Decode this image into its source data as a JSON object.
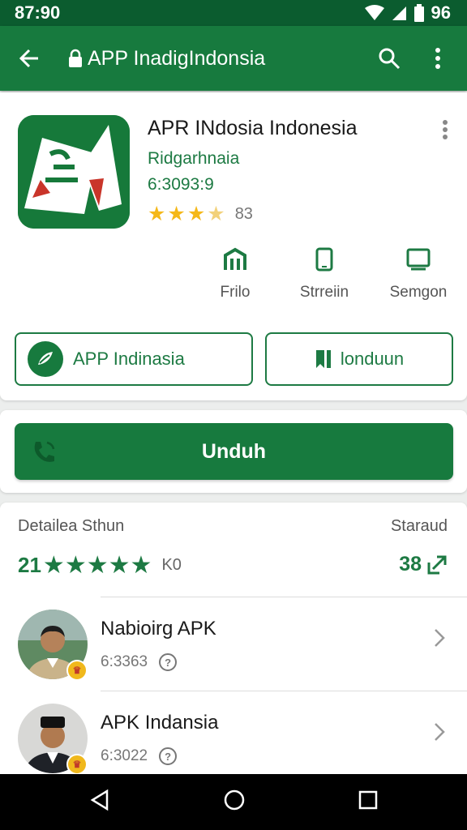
{
  "status_bar": {
    "time": "87:90",
    "battery": "96"
  },
  "app_bar": {
    "title": "APP InadigIndonsia"
  },
  "app": {
    "name": "APR INdosia Indonesia",
    "developer": "Ridgarhnaia",
    "version": "6:3093:9",
    "rating_count": "83",
    "stars": {
      "filled": 3,
      "half": 1,
      "total": 4
    }
  },
  "features": [
    {
      "icon": "building-icon",
      "label": "Frilo"
    },
    {
      "icon": "phone-device-icon",
      "label": "Strreiin"
    },
    {
      "icon": "tablet-icon",
      "label": "Semgon"
    }
  ],
  "buttons": {
    "left_label": "APP Indinasia",
    "right_label": "londuun",
    "install_label": "Unduh"
  },
  "details": {
    "title": "Detailea Sthun",
    "link": "Staraud",
    "rating_number": "21",
    "rating_stars": 5,
    "rating_count": "K0",
    "trend_value": "38"
  },
  "list": [
    {
      "title": "Nabioirg APK",
      "subtitle": "6:3363"
    },
    {
      "title": "APK Indansia",
      "subtitle": "6:3022"
    }
  ],
  "colors": {
    "primary": "#177a3e",
    "status_bar": "#0b5c2f",
    "star": "#f5b819"
  }
}
